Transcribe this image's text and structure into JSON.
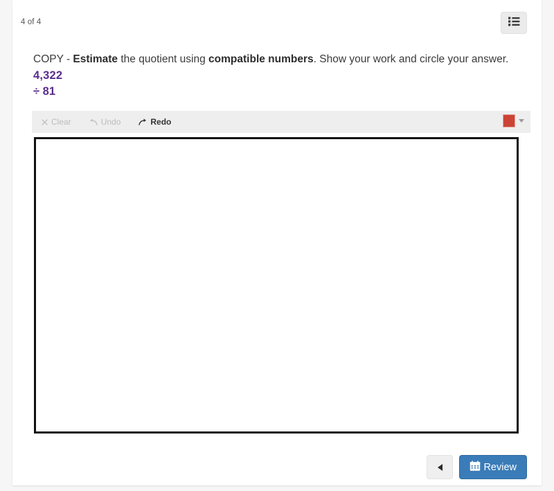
{
  "header": {
    "page_indicator": "4 of 4",
    "menu_button_name": "list-icon"
  },
  "question": {
    "prefix": "COPY - ",
    "bold1": "Estimate",
    "mid1": " the quotient using ",
    "bold2": "compatible numbers",
    "mid2": ". Show your work and circle your answer. ",
    "dividend": "4,322",
    "operator_line": "÷ 81"
  },
  "drawing_tools": {
    "clear_label": "Clear",
    "clear_enabled": false,
    "undo_label": "Undo",
    "undo_enabled": false,
    "redo_label": "Redo",
    "redo_enabled": true,
    "color_value": "#CB4335"
  },
  "footer": {
    "back_label": "",
    "review_label": "Review",
    "review_color": "#3A7CB8"
  },
  "colors": {
    "page_background": "#F6F6F6",
    "card_background": "#FFFFFF",
    "toolbar_background": "#EEEEEE",
    "expression_purple": "#5B2D8E",
    "canvas_border": "#111111",
    "text_primary": "#3B3B3B",
    "text_muted": "#BCBCBC"
  }
}
